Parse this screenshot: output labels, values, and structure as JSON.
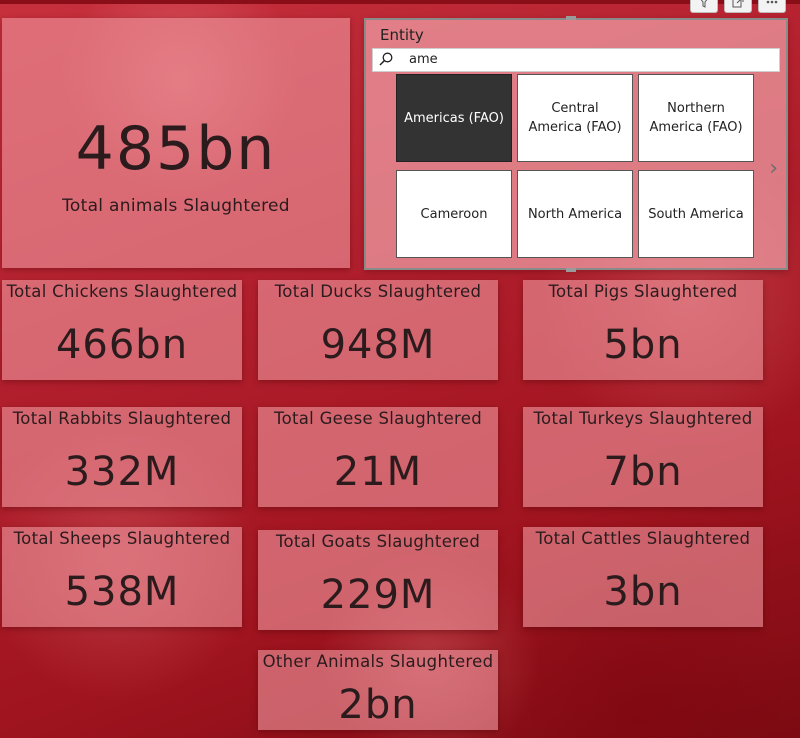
{
  "colors": {
    "card_bg": "#ee949c",
    "tile_selected": "#333333",
    "background": "#b3202e"
  },
  "toolbar_icons": [
    "filter-icon",
    "focus-mode-icon",
    "more-options-icon"
  ],
  "summary": {
    "value": "485bn",
    "label": "Total animals Slaughtered"
  },
  "slicer": {
    "title": "Entity",
    "search_value": "ame",
    "tiles": [
      {
        "label": "Americas (FAO)",
        "selected": true
      },
      {
        "label": "Central America (FAO)",
        "selected": false
      },
      {
        "label": "Northern America (FAO)",
        "selected": false
      },
      {
        "label": "Cameroon",
        "selected": false
      },
      {
        "label": "North America",
        "selected": false
      },
      {
        "label": "South America",
        "selected": false
      }
    ]
  },
  "cards": [
    {
      "label": "Total Chickens Slaughtered",
      "value": "466bn"
    },
    {
      "label": "Total Ducks Slaughtered",
      "value": "948M"
    },
    {
      "label": "Total Pigs Slaughtered",
      "value": "5bn"
    },
    {
      "label": "Total Rabbits Slaughtered",
      "value": "332M"
    },
    {
      "label": "Total Geese Slaughtered",
      "value": "21M"
    },
    {
      "label": "Total Turkeys Slaughtered",
      "value": "7bn"
    },
    {
      "label": "Total Sheeps Slaughtered",
      "value": "538M"
    },
    {
      "label": "Total Goats Slaughtered",
      "value": "229M"
    },
    {
      "label": "Total Cattles Slaughtered",
      "value": "3bn"
    },
    {
      "label": "Other Animals Slaughtered",
      "value": "2bn"
    }
  ]
}
